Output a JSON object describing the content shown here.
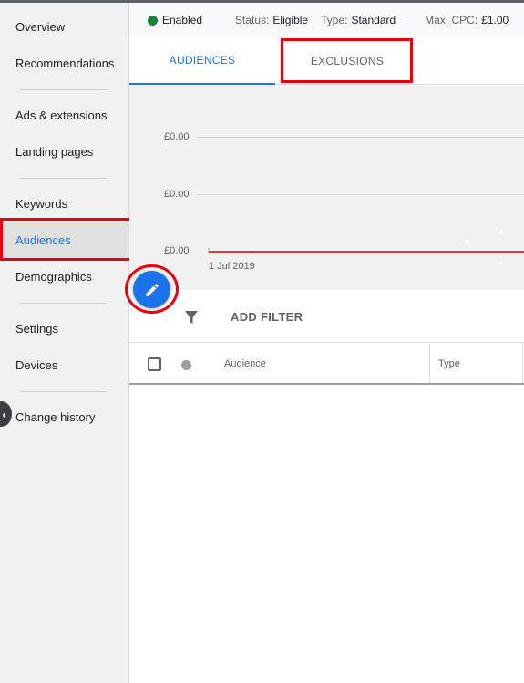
{
  "sidebar": {
    "items": [
      {
        "label": "Overview"
      },
      {
        "label": "Recommendations"
      },
      {
        "label": "Ads & extensions"
      },
      {
        "label": "Landing pages"
      },
      {
        "label": "Keywords"
      },
      {
        "label": "Audiences",
        "active": true
      },
      {
        "label": "Demographics"
      },
      {
        "label": "Settings"
      },
      {
        "label": "Devices"
      },
      {
        "label": "Change history"
      }
    ]
  },
  "status_bar": {
    "enabled": "Enabled",
    "status_label": "Status:",
    "status_value": "Eligible",
    "type_label": "Type:",
    "type_value": "Standard",
    "max_cpc_label": "Max. CPC:",
    "max_cpc_value": "£1.00"
  },
  "tabs": {
    "audiences": "AUDIENCES",
    "exclusions": "EXCLUSIONS"
  },
  "chart": {
    "y_ticks": [
      "£0.00",
      "£0.00",
      "£0.00"
    ],
    "x_tick": "1 Jul 2019"
  },
  "filter": {
    "label": "ADD FILTER"
  },
  "table": {
    "columns": [
      "Audience",
      "Type"
    ]
  },
  "colors": {
    "accent": "#1a73e8",
    "highlight": "#e8000b",
    "enabled_dot": "#188038",
    "series_line": "#d50000"
  }
}
